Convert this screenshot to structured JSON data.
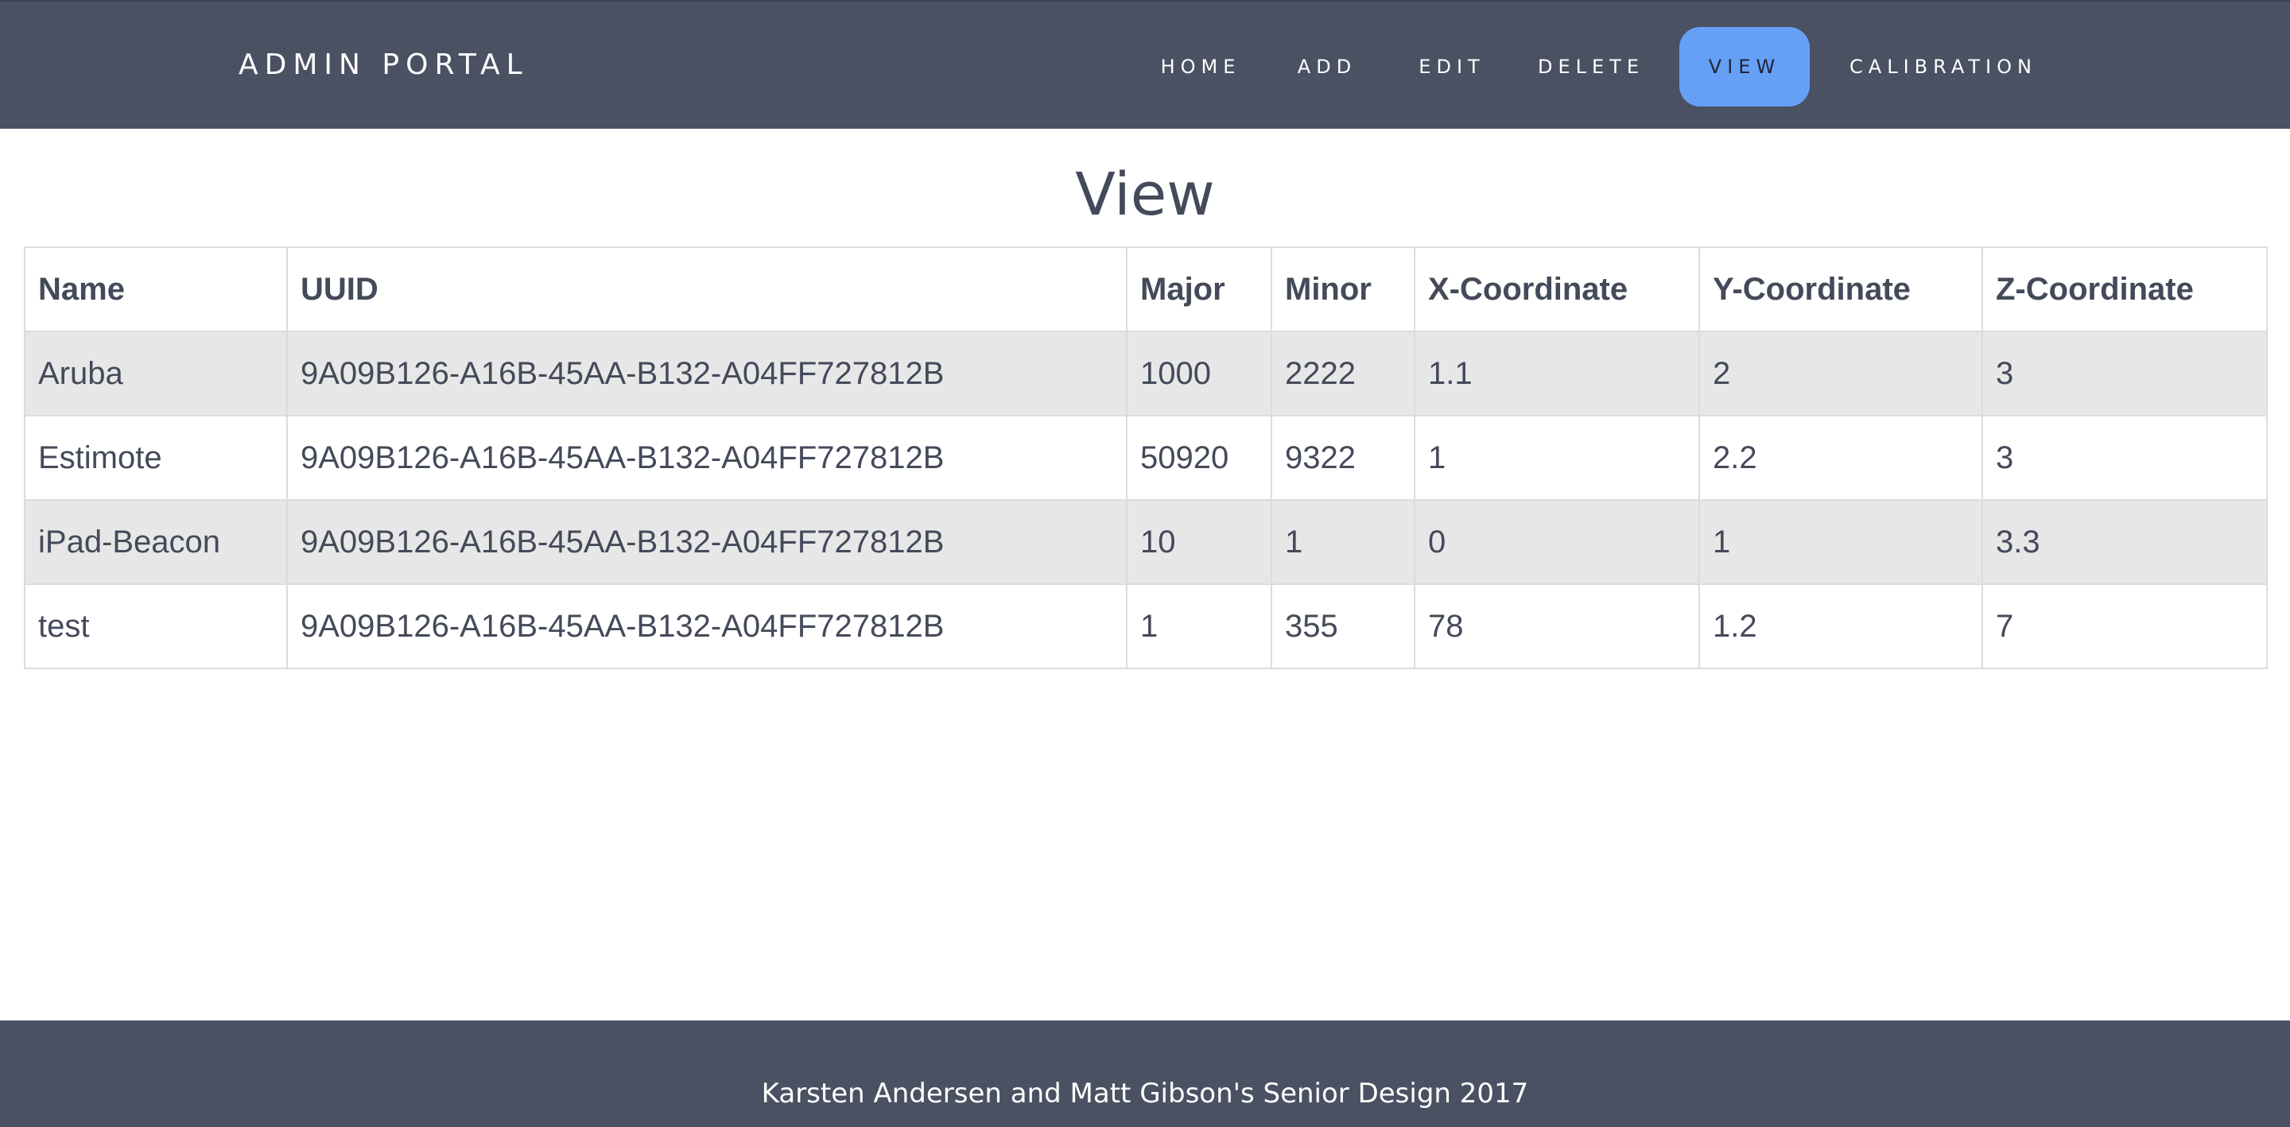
{
  "navbar": {
    "brand": "ADMIN PORTAL",
    "items": [
      {
        "label": "HOME",
        "active": false
      },
      {
        "label": "ADD",
        "active": false
      },
      {
        "label": "EDIT",
        "active": false
      },
      {
        "label": "DELETE",
        "active": false
      },
      {
        "label": "VIEW",
        "active": true
      },
      {
        "label": "CALIBRATION",
        "active": false
      }
    ],
    "background": "#4a5162",
    "active_color": "#66a0f6"
  },
  "page": {
    "title": "View"
  },
  "table": {
    "columns": [
      "Name",
      "UUID",
      "Major",
      "Minor",
      "X-Coordinate",
      "Y-Coordinate",
      "Z-Coordinate"
    ],
    "rows": [
      [
        "Aruba",
        "9A09B126-A16B-45AA-B132-A04FF727812B",
        "1000",
        "2222",
        "1.1",
        "2",
        "3"
      ],
      [
        "Estimote",
        "9A09B126-A16B-45AA-B132-A04FF727812B",
        "50920",
        "9322",
        "1",
        "2.2",
        "3"
      ],
      [
        "iPad-Beacon",
        "9A09B126-A16B-45AA-B132-A04FF727812B",
        "10",
        "1",
        "0",
        "1",
        "3.3"
      ],
      [
        "test",
        "9A09B126-A16B-45AA-B132-A04FF727812B",
        "1",
        "355",
        "78",
        "1.2",
        "7"
      ]
    ]
  },
  "footer": {
    "text": "Karsten Andersen and Matt Gibson's Senior Design 2017"
  }
}
